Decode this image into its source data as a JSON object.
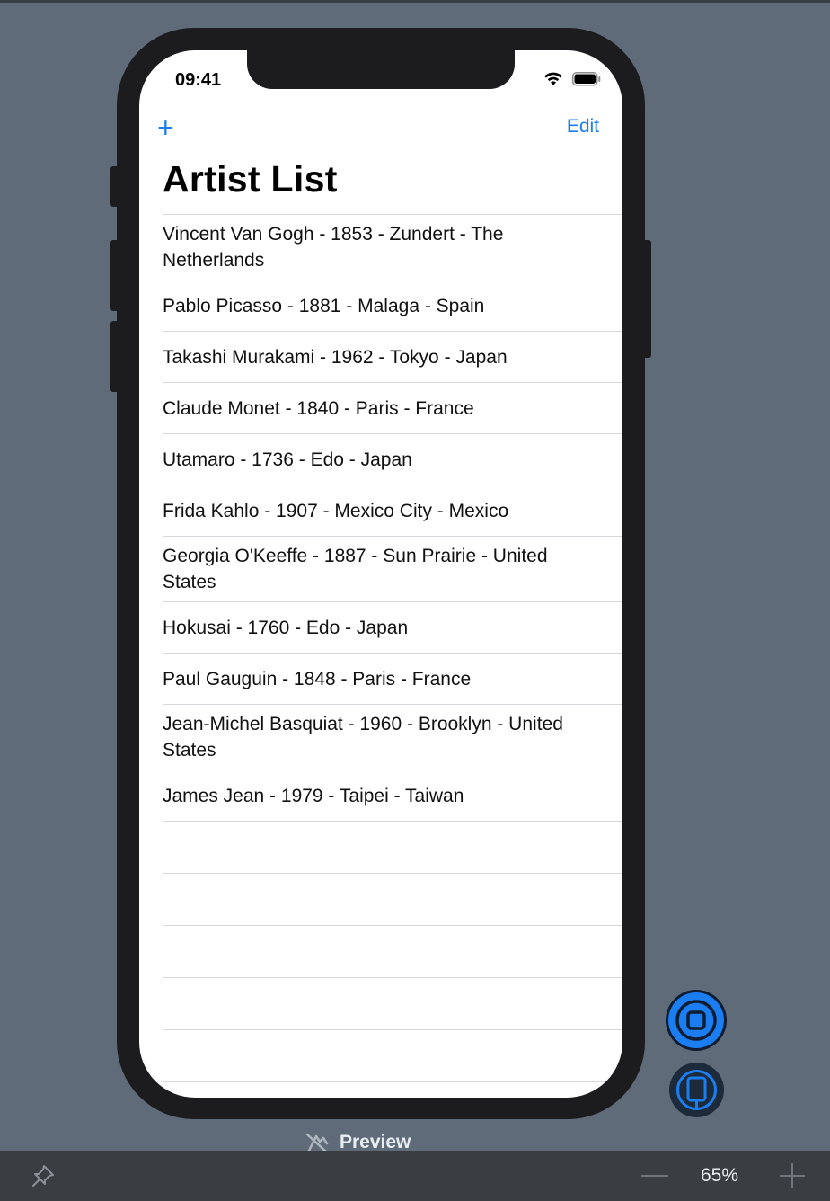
{
  "status_bar": {
    "time": "09:41"
  },
  "nav_bar": {
    "add_label": "+",
    "edit_label": "Edit",
    "title": "Artist List"
  },
  "artists": [
    "Vincent Van Gogh - 1853 - Zundert - The Netherlands",
    "Pablo Picasso - 1881 - Malaga - Spain",
    "Takashi Murakami - 1962 - Tokyo - Japan",
    "Claude Monet - 1840 - Paris - France",
    "Utamaro - 1736 - Edo - Japan",
    "Frida Kahlo - 1907 - Mexico City - Mexico",
    "Georgia O'Keeffe - 1887 - Sun Prairie - United States",
    "Hokusai - 1760 - Edo - Japan",
    "Paul Gauguin - 1848 - Paris - France",
    "Jean-Michel Basquiat - 1960 - Brooklyn - United States",
    "James Jean - 1979 - Taipei - Taiwan"
  ],
  "preview": {
    "label": "Preview"
  },
  "zoom": {
    "level": "65%"
  },
  "colors": {
    "accent": "#1a7ef2",
    "canvas": "#5f6b79",
    "bottom_bar": "#3a3d42"
  }
}
